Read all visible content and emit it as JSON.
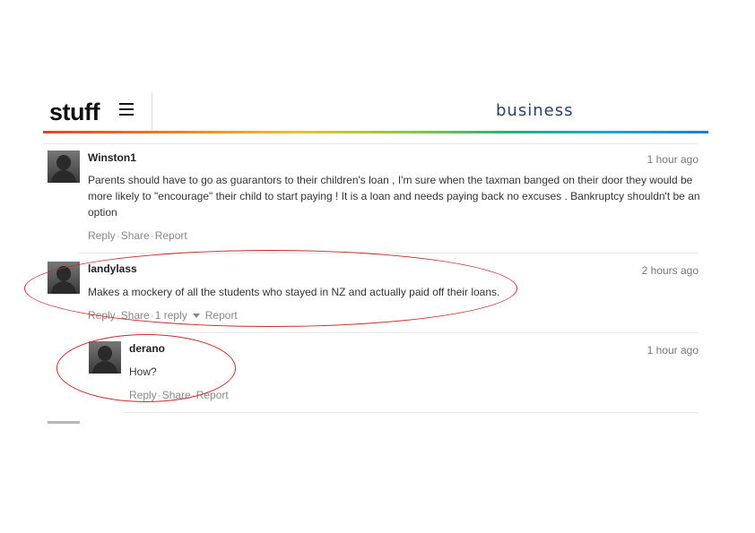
{
  "header": {
    "logo": "stuff",
    "section": "business"
  },
  "comments": [
    {
      "username": "Winston1",
      "time": "1 hour ago",
      "lines": [
        "Parents should have to go as guarantors to their children's loan , I'm sure when the taxman banged on their door they would be",
        "more likely to \"encourage\" their child to start paying ! It is a loan and needs paying back no excuses . Bankruptcy shouldn't be an",
        "option"
      ],
      "actions": {
        "reply": "Reply",
        "share": "Share",
        "report": "Report"
      }
    },
    {
      "username": "landylass",
      "time": "2 hours ago",
      "text": "Makes a mockery of all the students who stayed in NZ and actually paid off their loans.",
      "actions": {
        "reply": "Reply",
        "share": "Share",
        "replies": "1 reply",
        "report": "Report"
      }
    },
    {
      "username": "derano",
      "time": "1 hour ago",
      "text": "How?",
      "actions": {
        "reply": "Reply",
        "share": "Share",
        "report": "Report"
      }
    }
  ],
  "colors": {
    "annotation": "#cc2a2a",
    "section_title": "#2b3f6b"
  }
}
